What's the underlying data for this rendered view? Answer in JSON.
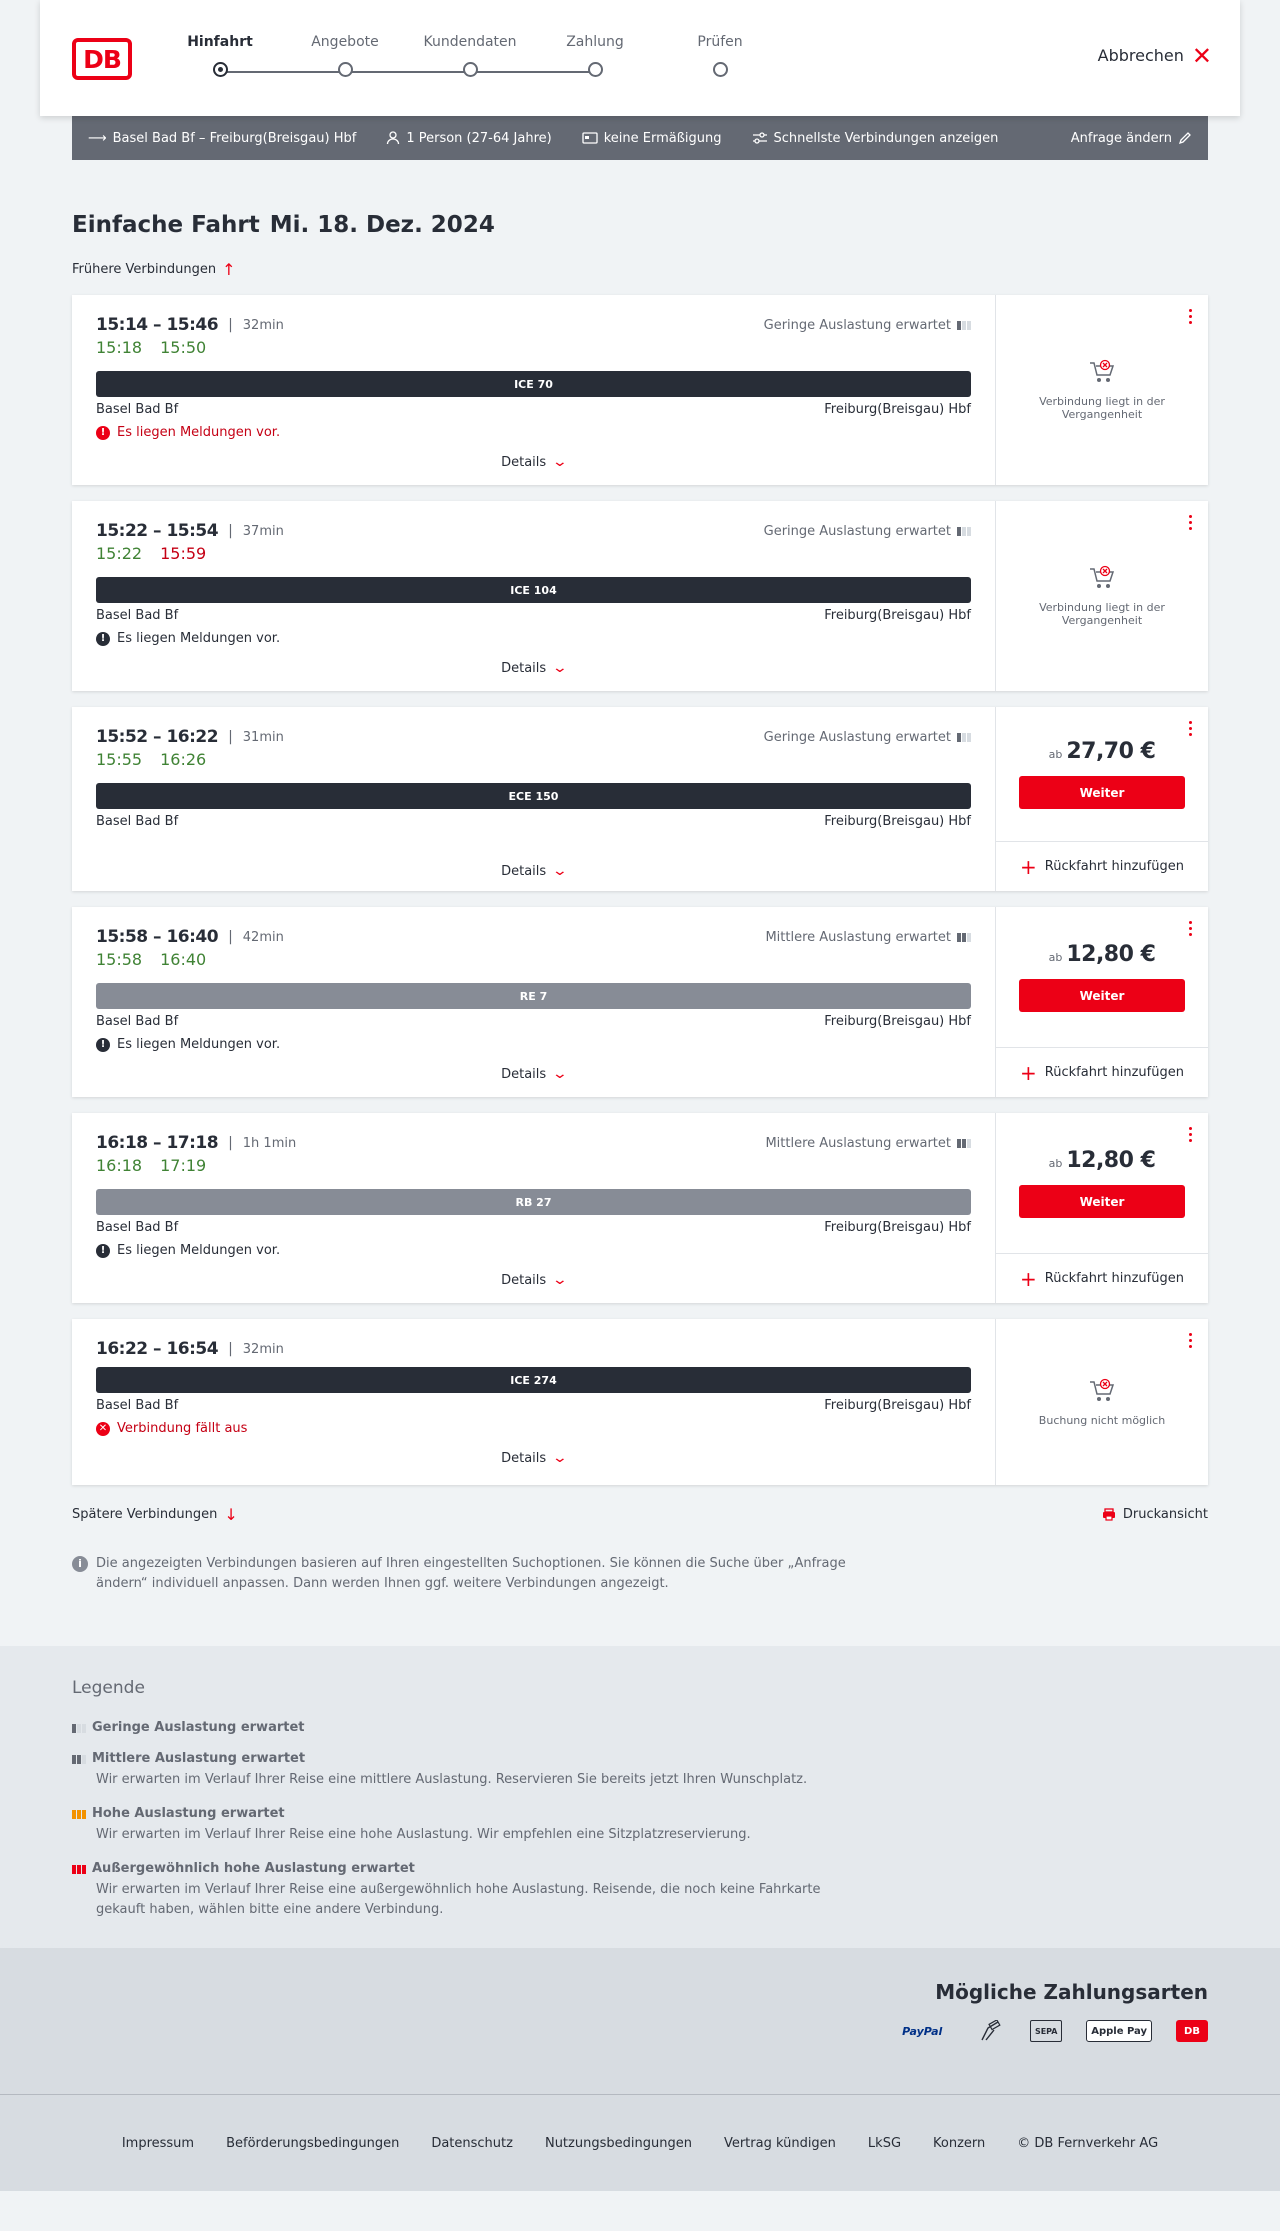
{
  "header": {
    "logo": "DB",
    "steps": [
      {
        "label": "Hinfahrt",
        "active": true
      },
      {
        "label": "Angebote",
        "active": false
      },
      {
        "label": "Kundendaten",
        "active": false
      },
      {
        "label": "Zahlung",
        "active": false
      },
      {
        "label": "Prüfen",
        "active": false
      }
    ],
    "cancel_label": "Abbrechen"
  },
  "query": {
    "route": "Basel Bad Bf – Freiburg(Breisgau) Hbf",
    "persons": "1 Person (27-64 Jahre)",
    "discount": "keine Ermäßigung",
    "fastest": "Schnellste Verbindungen anzeigen",
    "change": "Anfrage ändern"
  },
  "page": {
    "title": "Einfache Fahrt",
    "date": "Mi. 18. Dez. 2024",
    "earlier": "Frühere Verbindungen",
    "later": "Spätere Verbindungen",
    "print": "Druckansicht",
    "info": "Die angezeigten Verbindungen basieren auf Ihren eingestellten Suchoptionen. Sie können die Suche über „Anfrage ändern“ individuell anpassen. Dann werden Ihnen ggf. weitere Verbindungen angezeigt."
  },
  "connections": [
    {
      "times": "15:14 – 15:46",
      "duration": "32min",
      "load": "Geringe Auslastung erwartet",
      "load_level": 1,
      "rt_dep": "15:18",
      "rt_arr": "15:50",
      "rt_arr_delayed": false,
      "train": "ICE 70",
      "regional": false,
      "from": "Basel Bad Bf",
      "to": "Freiburg(Breisgau) Hbf",
      "message": "Es liegen Meldungen vor.",
      "message_red": true,
      "details": "Details",
      "status": "Verbindung liegt in der Vergangenheit"
    },
    {
      "times": "15:22 – 15:54",
      "duration": "37min",
      "load": "Geringe Auslastung erwartet",
      "load_level": 1,
      "rt_dep": "15:22",
      "rt_arr": "15:59",
      "rt_arr_delayed": true,
      "train": "ICE 104",
      "regional": false,
      "from": "Basel Bad Bf",
      "to": "Freiburg(Breisgau) Hbf",
      "message": "Es liegen Meldungen vor.",
      "message_red": false,
      "details": "Details",
      "status": "Verbindung liegt in der Vergangenheit"
    },
    {
      "times": "15:52 – 16:22",
      "duration": "31min",
      "load": "Geringe Auslastung erwartet",
      "load_level": 1,
      "rt_dep": "15:55",
      "rt_arr": "16:26",
      "rt_arr_delayed": false,
      "train": "ECE 150",
      "regional": false,
      "from": "Basel Bad Bf",
      "to": "Freiburg(Breisgau) Hbf",
      "message": "",
      "details": "Details",
      "price_prefix": "ab",
      "price": "27,70 €",
      "next_label": "Weiter",
      "return_label": "Rückfahrt hinzufügen"
    },
    {
      "times": "15:58 – 16:40",
      "duration": "42min",
      "load": "Mittlere Auslastung erwartet",
      "load_level": 2,
      "rt_dep": "15:58",
      "rt_arr": "16:40",
      "rt_arr_delayed": false,
      "train": "RE 7",
      "regional": true,
      "from": "Basel Bad Bf",
      "to": "Freiburg(Breisgau) Hbf",
      "message": "Es liegen Meldungen vor.",
      "message_red": false,
      "details": "Details",
      "price_prefix": "ab",
      "price": "12,80 €",
      "next_label": "Weiter",
      "return_label": "Rückfahrt hinzufügen"
    },
    {
      "times": "16:18 – 17:18",
      "duration": "1h 1min",
      "load": "Mittlere Auslastung erwartet",
      "load_level": 2,
      "rt_dep": "16:18",
      "rt_arr": "17:19",
      "rt_arr_delayed": false,
      "train": "RB 27",
      "regional": true,
      "from": "Basel Bad Bf",
      "to": "Freiburg(Breisgau) Hbf",
      "message": "Es liegen Meldungen vor.",
      "message_red": false,
      "details": "Details",
      "price_prefix": "ab",
      "price": "12,80 €",
      "next_label": "Weiter",
      "return_label": "Rückfahrt hinzufügen"
    },
    {
      "times": "16:22 – 16:54",
      "duration": "32min",
      "load": "",
      "load_level": 0,
      "rt_dep": "",
      "rt_arr": "",
      "rt_arr_delayed": false,
      "train": "ICE 274",
      "regional": false,
      "from": "Basel Bad Bf",
      "to": "Freiburg(Breisgau) Hbf",
      "message": "Verbindung fällt aus",
      "message_red": true,
      "message_cancel": true,
      "details": "Details",
      "status": "Buchung nicht möglich"
    }
  ],
  "legend": {
    "title": "Legende",
    "items": [
      {
        "title": "Geringe Auslastung erwartet",
        "desc": "",
        "level": 1,
        "color": "#646973"
      },
      {
        "title": "Mittlere Auslastung erwartet",
        "desc": "Wir erwarten im Verlauf Ihrer Reise eine mittlere Auslastung. Reservieren Sie bereits jetzt Ihren Wunschplatz.",
        "level": 2,
        "color": "#646973"
      },
      {
        "title": "Hohe Auslastung erwartet",
        "desc": "Wir erwarten im Verlauf Ihrer Reise eine hohe Auslastung. Wir empfehlen eine Sitzplatzreservierung.",
        "level": 3,
        "color": "#f39200"
      },
      {
        "title": "Außergewöhnlich hohe Auslastung erwartet",
        "desc": "Wir erwarten im Verlauf Ihrer Reise eine außergewöhnlich hohe Auslastung. Reisende, die noch keine Fahrkarte gekauft haben, wählen bitte eine andere Verbindung.",
        "level": 4,
        "color": "#ec0016"
      }
    ]
  },
  "payment": {
    "title": "Mögliche Zahlungsarten",
    "methods": [
      "PayPal",
      "Kreditkarte",
      "SEPA",
      "Apple Pay",
      "DB"
    ]
  },
  "footer": {
    "links": [
      "Impressum",
      "Beförderungsbedingungen",
      "Datenschutz",
      "Nutzungsbedingungen",
      "Vertrag kündigen",
      "LkSG",
      "Konzern",
      "© DB Fernverkehr AG"
    ]
  }
}
